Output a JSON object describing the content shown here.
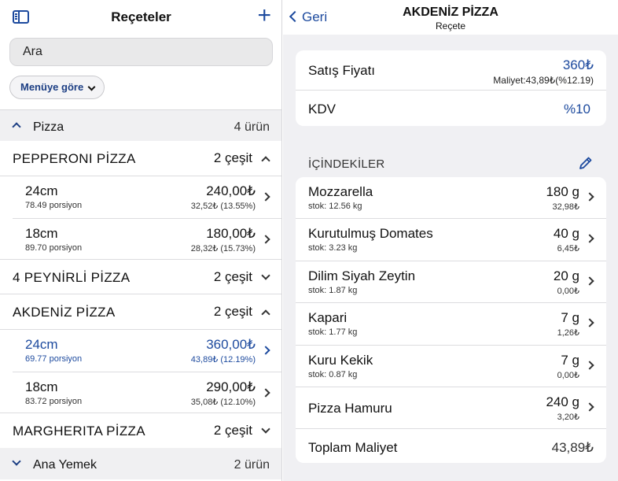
{
  "left": {
    "title": "Reçeteler",
    "add_label": "+",
    "search_placeholder": "Ara",
    "filter_label": "Menüye göre",
    "sections": [
      {
        "name": "Pizza",
        "count": "4 ürün",
        "expanded": true
      },
      {
        "name": "Ana Yemek",
        "count": "2 ürün",
        "expanded": false
      }
    ],
    "recipes": [
      {
        "name": "PEPPERONI PİZZA",
        "variants": "2 çeşit",
        "expanded": true,
        "items": [
          {
            "size": "24cm",
            "portion": "78.49 porsiyon",
            "price": "240,00₺",
            "cost": "32,52₺ (13.55%)"
          },
          {
            "size": "18cm",
            "portion": "89.70 porsiyon",
            "price": "180,00₺",
            "cost": "28,32₺ (15.73%)"
          }
        ]
      },
      {
        "name": "4 PEYNİRLİ PİZZA",
        "variants": "2 çeşit",
        "expanded": false,
        "items": []
      },
      {
        "name": "AKDENİZ PİZZA",
        "variants": "2 çeşit",
        "expanded": true,
        "items": [
          {
            "size": "24cm",
            "portion": "69.77 porsiyon",
            "price": "360,00₺",
            "cost": "43,89₺ (12.19%)",
            "active": true
          },
          {
            "size": "18cm",
            "portion": "83.72 porsiyon",
            "price": "290,00₺",
            "cost": "35,08₺ (12.10%)"
          }
        ]
      },
      {
        "name": "MARGHERITA PİZZA",
        "variants": "2 çeşit",
        "expanded": false,
        "items": []
      }
    ]
  },
  "detail": {
    "back_label": "Geri",
    "title": "AKDENİZ PİZZA",
    "subtitle": "Reçete",
    "price_label": "Satış Fiyatı",
    "price_value": "360₺",
    "price_cost": "Maliyet:43,89₺(%12.19)",
    "kdv_label": "KDV",
    "kdv_value": "%10",
    "ingredients_header": "İÇİNDEKİLER",
    "ingredients": [
      {
        "name": "Mozzarella",
        "stock": "stok: 12.56 kg",
        "qty": "180 g",
        "cost": "32,98₺"
      },
      {
        "name": "Kurutulmuş Domates",
        "stock": "stok: 3.23 kg",
        "qty": "40 g",
        "cost": "6,45₺"
      },
      {
        "name": "Dilim Siyah Zeytin",
        "stock": "stok: 1.87 kg",
        "qty": "20 g",
        "cost": "0,00₺"
      },
      {
        "name": "Kapari",
        "stock": "stok: 1.77 kg",
        "qty": "7 g",
        "cost": "1,26₺"
      },
      {
        "name": "Kuru Kekik",
        "stock": "stok: 0.87 kg",
        "qty": "7 g",
        "cost": "0,00₺"
      },
      {
        "name": "Pizza Hamuru",
        "stock": "",
        "qty": "240 g",
        "cost": "3,20₺"
      }
    ],
    "total_label": "Toplam Maliyet",
    "total_value": "43,89₺"
  },
  "colors": {
    "accent": "#1d4a9e",
    "background": "#f0f0f3"
  },
  "icons": [
    "sidebar-icon",
    "plus-icon",
    "chevron-down-icon",
    "chevron-up-icon",
    "chevron-right-icon",
    "chevron-left-icon",
    "pencil-icon"
  ]
}
